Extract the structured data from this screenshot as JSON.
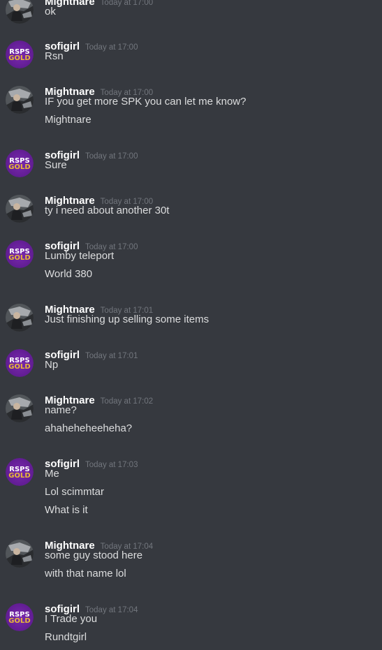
{
  "messages": [
    {
      "author": "Mightnare",
      "timestamp": "Today at 17:00",
      "avatar": "photo-avatar",
      "lines": [
        "ok"
      ]
    },
    {
      "author": "sofigirl",
      "timestamp": "Today at 17:00",
      "avatar": "rsps-gold-avatar",
      "avatar_text": [
        "RSPS",
        "GOLD"
      ],
      "lines": [
        "Rsn"
      ]
    },
    {
      "author": "Mightnare",
      "timestamp": "Today at 17:00",
      "avatar": "photo-avatar",
      "lines": [
        "IF you get more SPK you can let me know?",
        "Mightnare"
      ]
    },
    {
      "author": "sofigirl",
      "timestamp": "Today at 17:00",
      "avatar": "rsps-gold-avatar",
      "avatar_text": [
        "RSPS",
        "GOLD"
      ],
      "lines": [
        "Sure"
      ]
    },
    {
      "author": "Mightnare",
      "timestamp": "Today at 17:00",
      "avatar": "photo-avatar",
      "lines": [
        "ty i need about another 30t"
      ]
    },
    {
      "author": "sofigirl",
      "timestamp": "Today at 17:00",
      "avatar": "rsps-gold-avatar",
      "avatar_text": [
        "RSPS",
        "GOLD"
      ],
      "lines": [
        "Lumby teleport",
        "World 380"
      ]
    },
    {
      "author": "Mightnare",
      "timestamp": "Today at 17:01",
      "avatar": "photo-avatar",
      "lines": [
        "Just finishing up selling some items"
      ]
    },
    {
      "author": "sofigirl",
      "timestamp": "Today at 17:01",
      "avatar": "rsps-gold-avatar",
      "avatar_text": [
        "RSPS",
        "GOLD"
      ],
      "lines": [
        "Np"
      ]
    },
    {
      "author": "Mightnare",
      "timestamp": "Today at 17:02",
      "avatar": "photo-avatar",
      "lines": [
        "name?",
        "ahaheheheeheha?"
      ]
    },
    {
      "author": "sofigirl",
      "timestamp": "Today at 17:03",
      "avatar": "rsps-gold-avatar",
      "avatar_text": [
        "RSPS",
        "GOLD"
      ],
      "lines": [
        "Me",
        "Lol scimmtar",
        "What is it"
      ]
    },
    {
      "author": "Mightnare",
      "timestamp": "Today at 17:04",
      "avatar": "photo-avatar",
      "lines": [
        "some guy stood here",
        "with that name lol"
      ]
    },
    {
      "author": "sofigirl",
      "timestamp": "Today at 17:04",
      "avatar": "rsps-gold-avatar",
      "avatar_text": [
        "RSPS",
        "GOLD"
      ],
      "lines": [
        "I Trade you",
        "Rundtgirl"
      ]
    }
  ],
  "colors": {
    "background": "#36393f",
    "username": "#ffffff",
    "timestamp": "#72767d",
    "message_text": "#dcddde",
    "rsps_avatar_purple": "#5b1a8c",
    "rsps_text": "#ffffff",
    "gold_text": "#e8b838"
  }
}
